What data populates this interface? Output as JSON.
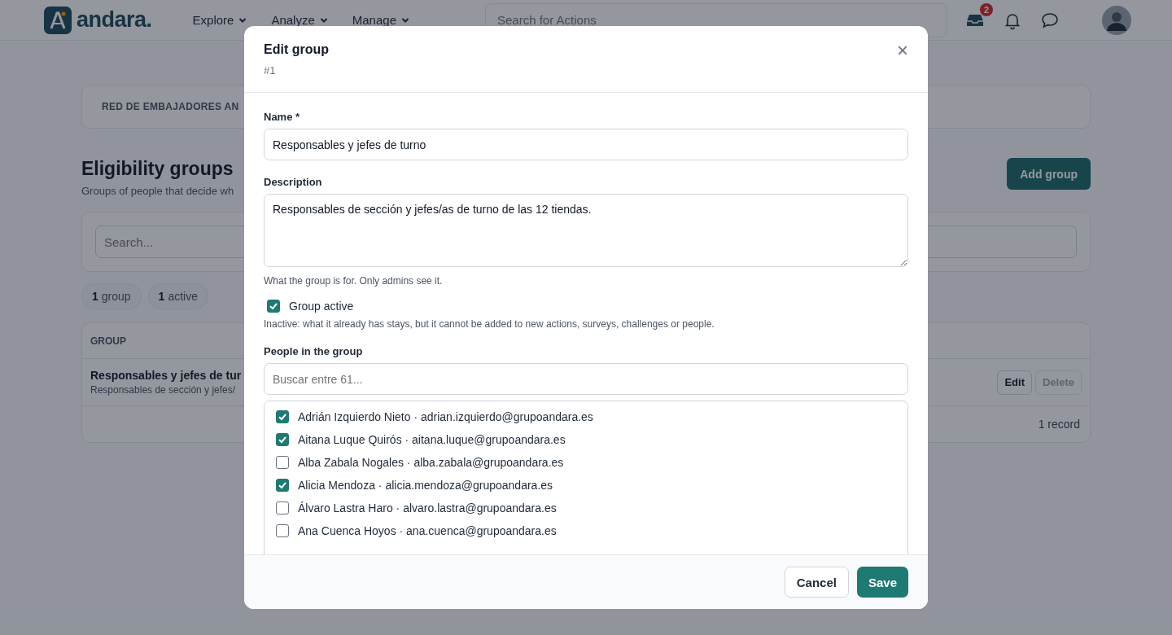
{
  "nav": {
    "brand": "andara.",
    "menus": [
      "Explore",
      "Analyze",
      "Manage"
    ],
    "search_placeholder": "Search for Actions",
    "inbox_badge": "2"
  },
  "page": {
    "breadcrumb": "RED DE EMBAJADORES AN",
    "title": "Eligibility groups",
    "subtitle": "Groups of people that decide wh",
    "add_button": "Add group",
    "search_placeholder": "Search...",
    "counters": [
      {
        "count": "1",
        "label": "group"
      },
      {
        "count": "1",
        "label": "active"
      }
    ],
    "table": {
      "column_1": "GROUP",
      "rows": [
        {
          "name": "Responsables y jefes de tur",
          "description": "Responsables de sección y jefes/",
          "actions": [
            {
              "label": "Edit",
              "disabled": false
            },
            {
              "label": "Delete",
              "disabled": true
            }
          ]
        }
      ],
      "footer": "1 record"
    }
  },
  "modal": {
    "title": "Edit group",
    "subtitle": "#1",
    "close": "×",
    "name_label": "Name *",
    "name_value": "Responsables y jefes de turno",
    "description_label": "Description",
    "description_value": "Responsables de sección y jefes/as de turno de las 12 tiendas.",
    "description_hint": "What the group is for. Only admins see it.",
    "active": {
      "label": "Group active",
      "checked": true,
      "hint": "Inactive: what it already has stays, but it cannot be added to new actions, surveys, challenges or people."
    },
    "people_label": "People in the group",
    "people_search_placeholder": "Buscar entre 61...",
    "people": [
      {
        "label": "Adrián Izquierdo Nieto · adrian.izquierdo@grupoandara.es",
        "checked": true
      },
      {
        "label": "Aitana Luque Quirós · aitana.luque@grupoandara.es",
        "checked": true
      },
      {
        "label": "Alba Zabala Nogales · alba.zabala@grupoandara.es",
        "checked": false
      },
      {
        "label": "Alicia Mendoza · alicia.mendoza@grupoandara.es",
        "checked": true
      },
      {
        "label": "Álvaro Lastra Haro · alvaro.lastra@grupoandara.es",
        "checked": false
      },
      {
        "label": "Ana Cuenca Hoyos · ana.cuenca@grupoandara.es",
        "checked": false
      }
    ],
    "buttons": [
      {
        "label": "Cancel",
        "kind": "secondary"
      },
      {
        "label": "Save",
        "kind": "primary"
      }
    ]
  }
}
